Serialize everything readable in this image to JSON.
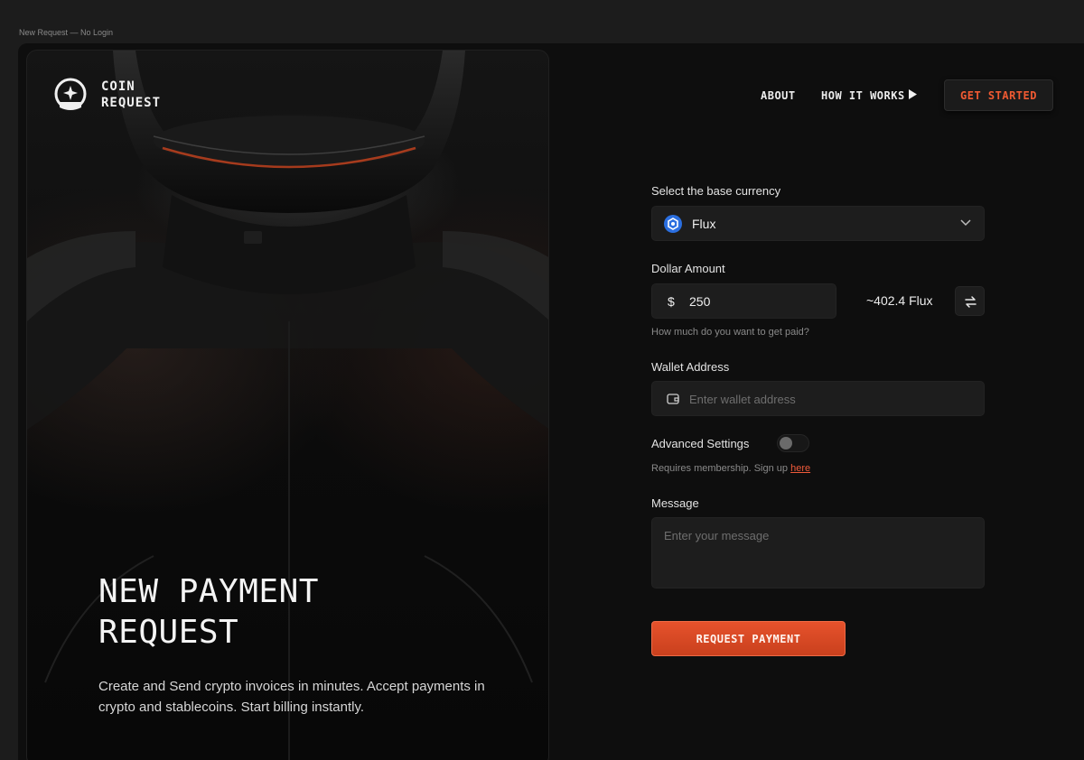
{
  "frame": {
    "label": "New Request — No Login"
  },
  "brand": {
    "line1": "COIN",
    "line2": "REQUEST",
    "logo_icon": "astronaut-helmet-icon"
  },
  "nav": {
    "about": "ABOUT",
    "how_it_works": "HOW IT WORKS",
    "play_icon": "play-icon",
    "get_started": "GET STARTED"
  },
  "hero": {
    "title_line1": "NEW PAYMENT",
    "title_line2": "REQUEST",
    "description": "Create and Send crypto invoices in minutes. Accept payments in crypto and stablecoins. Start billing instantly."
  },
  "form": {
    "currency_label": "Select the base currency",
    "currency_value": "Flux",
    "currency_icon": "flux-coin-icon",
    "amount_label": "Dollar Amount",
    "amount_symbol": "$",
    "amount_value": "250",
    "converted": "~402.4 Flux",
    "amount_hint": "How much do you want to get paid?",
    "wallet_label": "Wallet Address",
    "wallet_placeholder": "Enter wallet address",
    "advanced_label": "Advanced Settings",
    "advanced_enabled": false,
    "membership_text": "Requires membership. Sign up ",
    "membership_link": "here",
    "message_label": "Message",
    "message_placeholder": "Enter your message",
    "submit_label": "REQUEST PAYMENT"
  },
  "colors": {
    "accent": "#e6522c",
    "background": "#0e0e0e",
    "field": "#1d1d1d",
    "flux_blue": "#2b6fe0"
  }
}
